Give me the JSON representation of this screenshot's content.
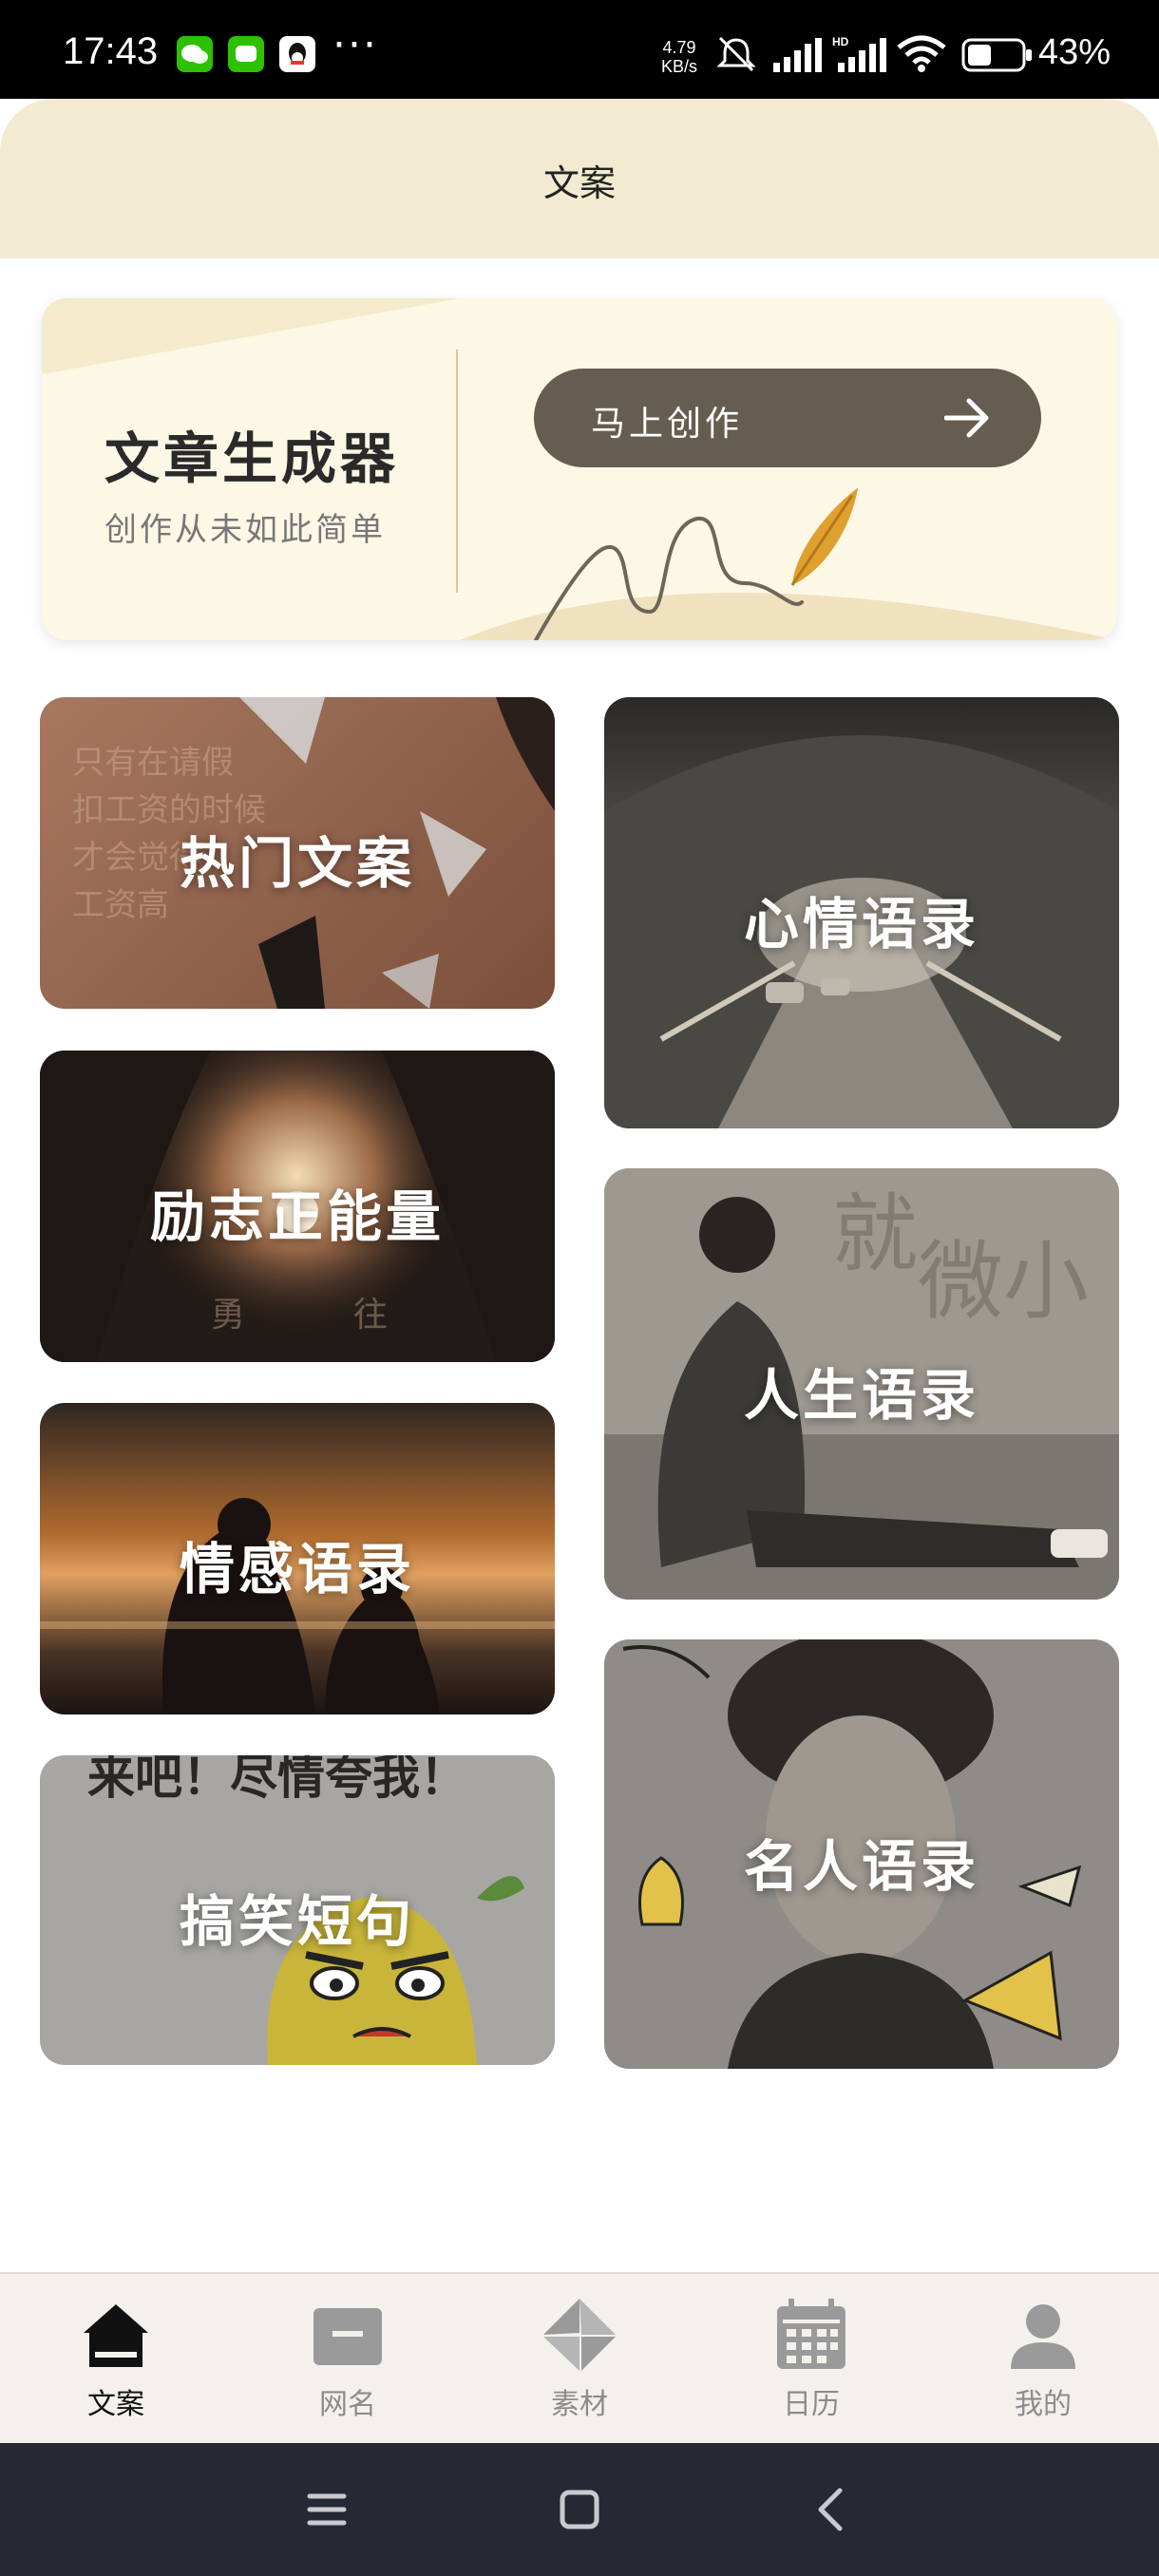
{
  "status_bar": {
    "time": "17:43",
    "more": "···",
    "net_speed_value": "4.79",
    "net_speed_unit": "KB/s",
    "battery": "43%"
  },
  "header": {
    "title": "文案"
  },
  "banner": {
    "title": "文章生成器",
    "subtitle": "创作从未如此简单",
    "button_label": "马上创作"
  },
  "categories": {
    "hot": "热门文案",
    "inspirational": "励志正能量",
    "emotion": "情感语录",
    "funny": "搞笑短句",
    "mood": "心情语录",
    "life": "人生语录",
    "famous": "名人语录"
  },
  "bottom_nav": {
    "items": [
      {
        "label": "文案",
        "icon": "home-icon",
        "active": true
      },
      {
        "label": "网名",
        "icon": "id-card-icon",
        "active": false
      },
      {
        "label": "素材",
        "icon": "material-icon",
        "active": false
      },
      {
        "label": "日历",
        "icon": "calendar-icon",
        "active": false
      },
      {
        "label": "我的",
        "icon": "profile-icon",
        "active": false
      }
    ]
  },
  "colors": {
    "header_bg": "#f3ebd1",
    "banner_bg": "#fdf7e5",
    "button_bg": "#655e50",
    "accent_feather": "#e0a030",
    "nav_bg": "#f4f1ec",
    "system_nav_bg": "#262833"
  }
}
